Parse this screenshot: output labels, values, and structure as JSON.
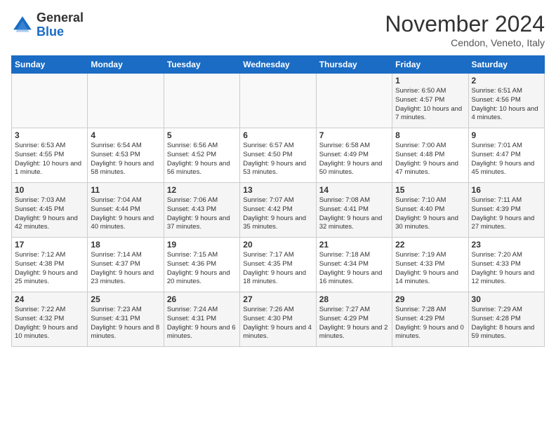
{
  "logo": {
    "general": "General",
    "blue": "Blue"
  },
  "title": "November 2024",
  "location": "Cendon, Veneto, Italy",
  "headers": [
    "Sunday",
    "Monday",
    "Tuesday",
    "Wednesday",
    "Thursday",
    "Friday",
    "Saturday"
  ],
  "weeks": [
    [
      {
        "day": "",
        "info": ""
      },
      {
        "day": "",
        "info": ""
      },
      {
        "day": "",
        "info": ""
      },
      {
        "day": "",
        "info": ""
      },
      {
        "day": "",
        "info": ""
      },
      {
        "day": "1",
        "info": "Sunrise: 6:50 AM\nSunset: 4:57 PM\nDaylight: 10 hours and 7 minutes."
      },
      {
        "day": "2",
        "info": "Sunrise: 6:51 AM\nSunset: 4:56 PM\nDaylight: 10 hours and 4 minutes."
      }
    ],
    [
      {
        "day": "3",
        "info": "Sunrise: 6:53 AM\nSunset: 4:55 PM\nDaylight: 10 hours and 1 minute."
      },
      {
        "day": "4",
        "info": "Sunrise: 6:54 AM\nSunset: 4:53 PM\nDaylight: 9 hours and 58 minutes."
      },
      {
        "day": "5",
        "info": "Sunrise: 6:56 AM\nSunset: 4:52 PM\nDaylight: 9 hours and 56 minutes."
      },
      {
        "day": "6",
        "info": "Sunrise: 6:57 AM\nSunset: 4:50 PM\nDaylight: 9 hours and 53 minutes."
      },
      {
        "day": "7",
        "info": "Sunrise: 6:58 AM\nSunset: 4:49 PM\nDaylight: 9 hours and 50 minutes."
      },
      {
        "day": "8",
        "info": "Sunrise: 7:00 AM\nSunset: 4:48 PM\nDaylight: 9 hours and 47 minutes."
      },
      {
        "day": "9",
        "info": "Sunrise: 7:01 AM\nSunset: 4:47 PM\nDaylight: 9 hours and 45 minutes."
      }
    ],
    [
      {
        "day": "10",
        "info": "Sunrise: 7:03 AM\nSunset: 4:45 PM\nDaylight: 9 hours and 42 minutes."
      },
      {
        "day": "11",
        "info": "Sunrise: 7:04 AM\nSunset: 4:44 PM\nDaylight: 9 hours and 40 minutes."
      },
      {
        "day": "12",
        "info": "Sunrise: 7:06 AM\nSunset: 4:43 PM\nDaylight: 9 hours and 37 minutes."
      },
      {
        "day": "13",
        "info": "Sunrise: 7:07 AM\nSunset: 4:42 PM\nDaylight: 9 hours and 35 minutes."
      },
      {
        "day": "14",
        "info": "Sunrise: 7:08 AM\nSunset: 4:41 PM\nDaylight: 9 hours and 32 minutes."
      },
      {
        "day": "15",
        "info": "Sunrise: 7:10 AM\nSunset: 4:40 PM\nDaylight: 9 hours and 30 minutes."
      },
      {
        "day": "16",
        "info": "Sunrise: 7:11 AM\nSunset: 4:39 PM\nDaylight: 9 hours and 27 minutes."
      }
    ],
    [
      {
        "day": "17",
        "info": "Sunrise: 7:12 AM\nSunset: 4:38 PM\nDaylight: 9 hours and 25 minutes."
      },
      {
        "day": "18",
        "info": "Sunrise: 7:14 AM\nSunset: 4:37 PM\nDaylight: 9 hours and 23 minutes."
      },
      {
        "day": "19",
        "info": "Sunrise: 7:15 AM\nSunset: 4:36 PM\nDaylight: 9 hours and 20 minutes."
      },
      {
        "day": "20",
        "info": "Sunrise: 7:17 AM\nSunset: 4:35 PM\nDaylight: 9 hours and 18 minutes."
      },
      {
        "day": "21",
        "info": "Sunrise: 7:18 AM\nSunset: 4:34 PM\nDaylight: 9 hours and 16 minutes."
      },
      {
        "day": "22",
        "info": "Sunrise: 7:19 AM\nSunset: 4:33 PM\nDaylight: 9 hours and 14 minutes."
      },
      {
        "day": "23",
        "info": "Sunrise: 7:20 AM\nSunset: 4:33 PM\nDaylight: 9 hours and 12 minutes."
      }
    ],
    [
      {
        "day": "24",
        "info": "Sunrise: 7:22 AM\nSunset: 4:32 PM\nDaylight: 9 hours and 10 minutes."
      },
      {
        "day": "25",
        "info": "Sunrise: 7:23 AM\nSunset: 4:31 PM\nDaylight: 9 hours and 8 minutes."
      },
      {
        "day": "26",
        "info": "Sunrise: 7:24 AM\nSunset: 4:31 PM\nDaylight: 9 hours and 6 minutes."
      },
      {
        "day": "27",
        "info": "Sunrise: 7:26 AM\nSunset: 4:30 PM\nDaylight: 9 hours and 4 minutes."
      },
      {
        "day": "28",
        "info": "Sunrise: 7:27 AM\nSunset: 4:29 PM\nDaylight: 9 hours and 2 minutes."
      },
      {
        "day": "29",
        "info": "Sunrise: 7:28 AM\nSunset: 4:29 PM\nDaylight: 9 hours and 0 minutes."
      },
      {
        "day": "30",
        "info": "Sunrise: 7:29 AM\nSunset: 4:28 PM\nDaylight: 8 hours and 59 minutes."
      }
    ]
  ]
}
